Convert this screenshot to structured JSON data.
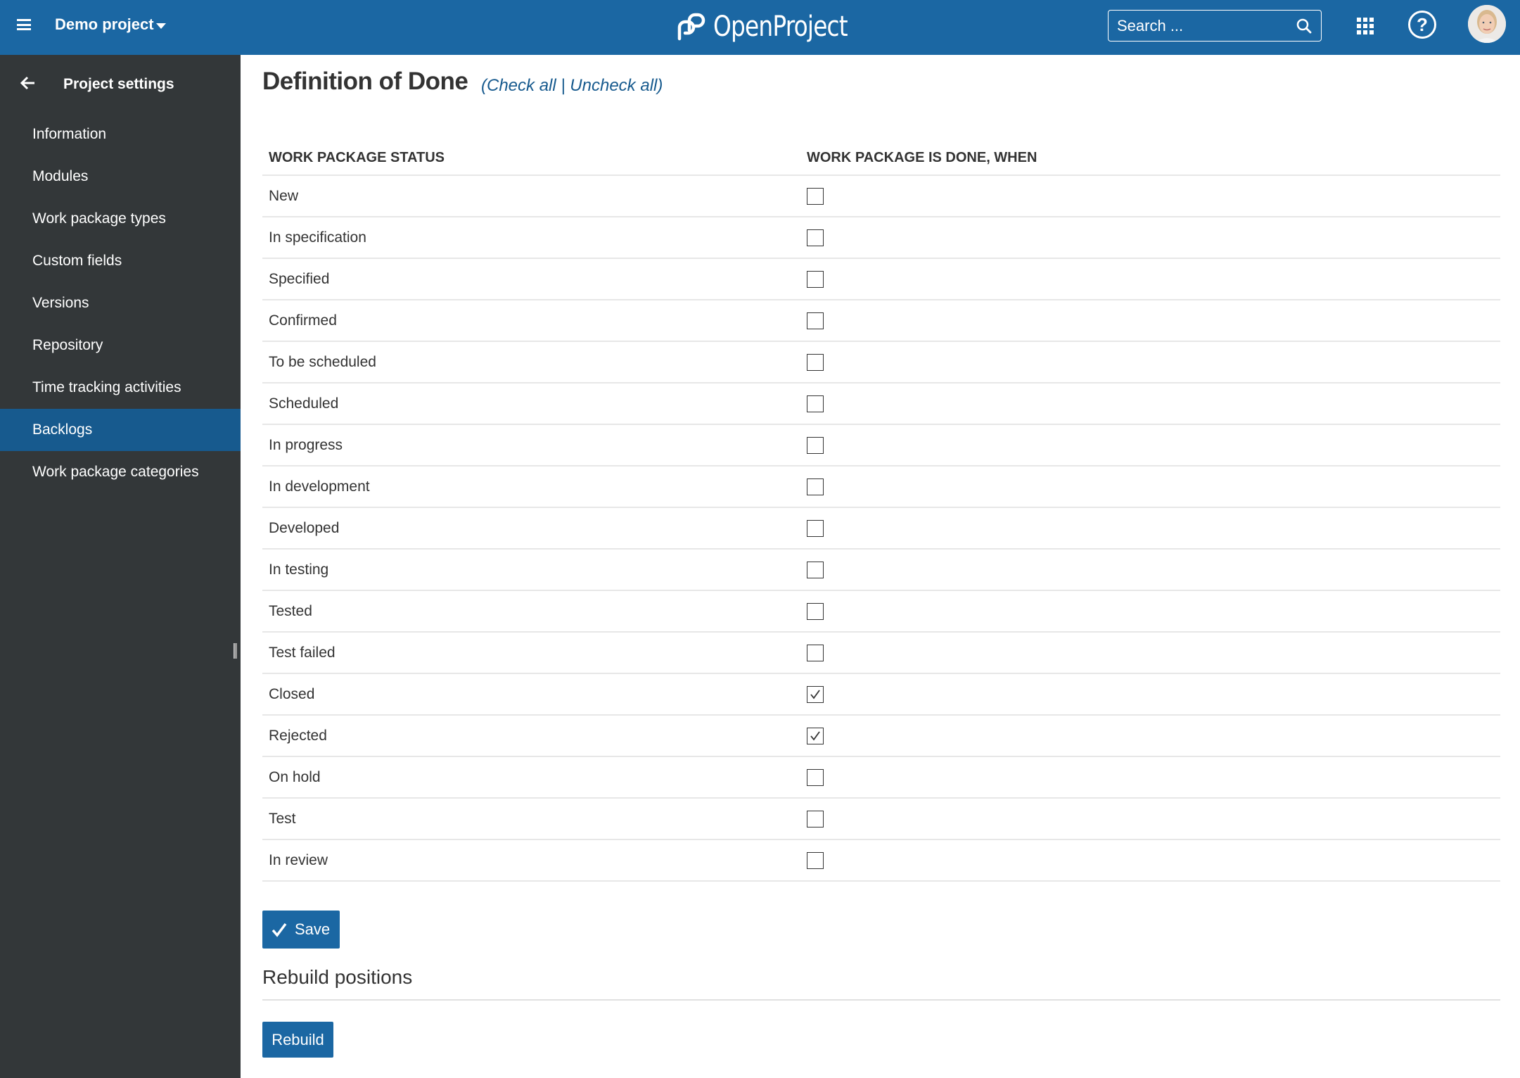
{
  "header": {
    "project_name": "Demo project",
    "logo_text": "OpenProject",
    "search_placeholder": "Search ...",
    "help_label": "?"
  },
  "sidebar": {
    "title": "Project settings",
    "items": [
      {
        "label": "Information",
        "active": false
      },
      {
        "label": "Modules",
        "active": false
      },
      {
        "label": "Work package types",
        "active": false
      },
      {
        "label": "Custom fields",
        "active": false
      },
      {
        "label": "Versions",
        "active": false
      },
      {
        "label": "Repository",
        "active": false
      },
      {
        "label": "Time tracking activities",
        "active": false
      },
      {
        "label": "Backlogs",
        "active": true
      },
      {
        "label": "Work package categories",
        "active": false
      }
    ]
  },
  "main": {
    "title": "Definition of Done",
    "paren_open": "(",
    "check_all": "Check all",
    "separator": " | ",
    "uncheck_all": "Uncheck all",
    "paren_close": ")",
    "table": {
      "columns": [
        "WORK PACKAGE STATUS",
        "WORK PACKAGE IS DONE, WHEN"
      ],
      "rows": [
        {
          "status": "New",
          "done": false
        },
        {
          "status": "In specification",
          "done": false
        },
        {
          "status": "Specified",
          "done": false
        },
        {
          "status": "Confirmed",
          "done": false
        },
        {
          "status": "To be scheduled",
          "done": false
        },
        {
          "status": "Scheduled",
          "done": false
        },
        {
          "status": "In progress",
          "done": false
        },
        {
          "status": "In development",
          "done": false
        },
        {
          "status": "Developed",
          "done": false
        },
        {
          "status": "In testing",
          "done": false
        },
        {
          "status": "Tested",
          "done": false
        },
        {
          "status": "Test failed",
          "done": false
        },
        {
          "status": "Closed",
          "done": true
        },
        {
          "status": "Rejected",
          "done": true
        },
        {
          "status": "On hold",
          "done": false
        },
        {
          "status": "Test",
          "done": false
        },
        {
          "status": "In review",
          "done": false
        }
      ]
    },
    "save_label": "Save",
    "rebuild_section_title": "Rebuild positions",
    "rebuild_label": "Rebuild"
  },
  "colors": {
    "header_bg": "#1b67a3",
    "sidebar_bg": "#333739",
    "sidebar_active": "#175a8e",
    "link": "#175a8e"
  }
}
